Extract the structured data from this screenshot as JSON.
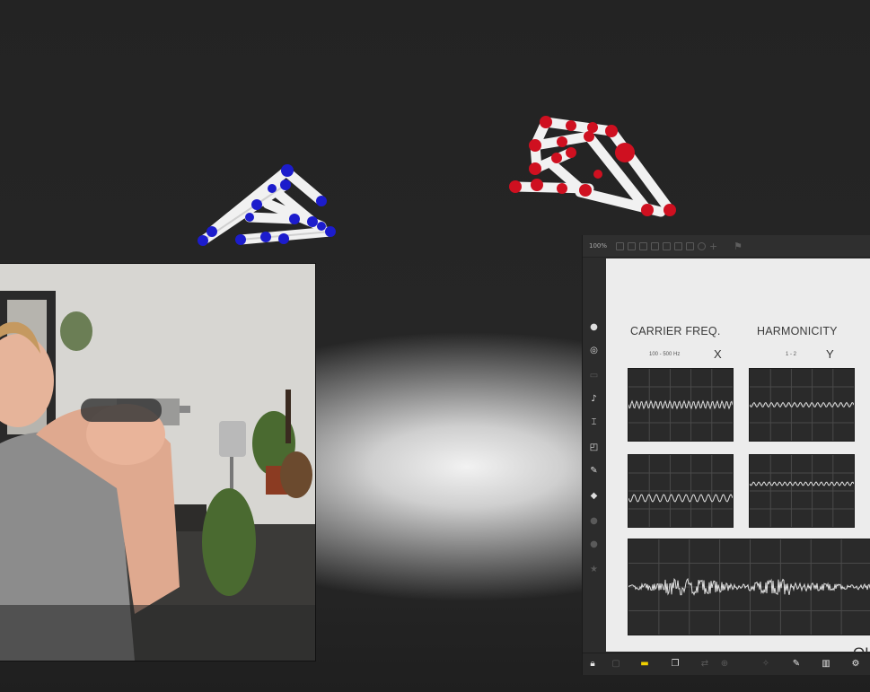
{
  "patcher": {
    "zoom": "100%",
    "toolbar_icons": [
      "new-patcher-icon",
      "copy-icon",
      "comment-icon",
      "grid-icon",
      "presentation-icon",
      "inspector-icon",
      "lock-view-icon",
      "info-icon",
      "add-icon",
      "debug-icon"
    ],
    "sidebar_icons": [
      "objects-icon",
      "settings-icon",
      "view-icon",
      "music-icon",
      "device-icon",
      "layout-icon",
      "paperclip-icon",
      "plug-icon",
      "help-icon",
      "reference-icon",
      "star-icon"
    ],
    "bottom_icons": [
      "lock-icon",
      "presentation-mode-icon",
      "chat-icon",
      "layers-icon",
      "audio-io-icon",
      "midi-icon",
      "debug-icon",
      "wrench-icon",
      "keyboard-icon",
      "mixer-icon"
    ]
  },
  "panel": {
    "carrier": {
      "title": "CARRIER FREQ.",
      "range": "100 - 500 Hz",
      "axis": "X"
    },
    "harmonicity": {
      "title": "HARMONICITY",
      "range": "1 - 2",
      "axis": "Y"
    },
    "output_label": "OU"
  },
  "colors": {
    "left_hand_joint": "#1c1ccc",
    "right_hand_joint": "#cf1020",
    "bone": "#f1f1f1",
    "scope_bg": "#2a2a2a",
    "scope_trace": "#e0e0e0",
    "canvas_bg": "#ececec"
  }
}
